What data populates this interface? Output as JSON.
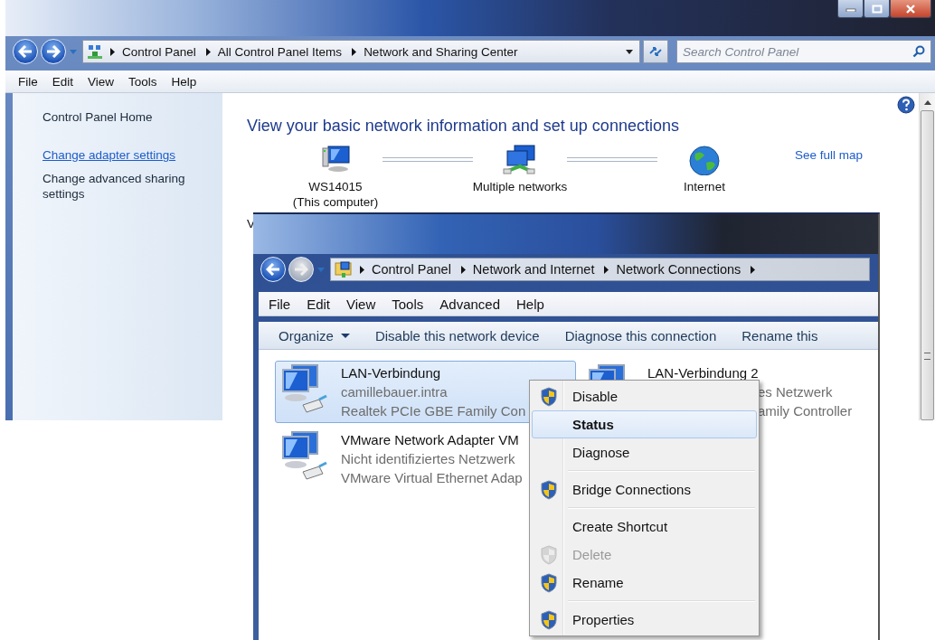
{
  "back_window": {
    "address_bar": {
      "crumbs": [
        "Control Panel",
        "All Control Panel Items",
        "Network and Sharing Center"
      ]
    },
    "search": {
      "placeholder": "Search Control Panel"
    },
    "menu": [
      "File",
      "Edit",
      "View",
      "Tools",
      "Help"
    ],
    "sidebar": {
      "items": [
        {
          "label": "Control Panel Home",
          "kind": "text"
        },
        {
          "label": "Change adapter settings",
          "kind": "link"
        },
        {
          "label": "Change advanced sharing settings",
          "kind": "text"
        }
      ]
    },
    "heading": "View your basic network information and set up connections",
    "map": {
      "nodes": [
        {
          "label": "WS14015",
          "sublabel": "(This computer)",
          "kind": "computer"
        },
        {
          "label": "Multiple networks",
          "kind": "network"
        },
        {
          "label": "Internet",
          "kind": "globe"
        }
      ]
    },
    "see_full_map": "See full map",
    "cut_text": "V"
  },
  "front_window": {
    "address_bar": {
      "crumbs": [
        "Control Panel",
        "Network and Internet",
        "Network Connections"
      ]
    },
    "menu": [
      "File",
      "Edit",
      "View",
      "Tools",
      "Advanced",
      "Help"
    ],
    "toolbar": [
      {
        "label": "Organize",
        "dropdown": true
      },
      {
        "label": "Disable this network device",
        "dropdown": false
      },
      {
        "label": "Diagnose this connection",
        "dropdown": false
      },
      {
        "label": "Rename this",
        "dropdown": false
      }
    ],
    "connections": [
      {
        "name": "LAN-Verbindung",
        "network": "camillebauer.intra",
        "adapter": "Realtek PCIe GBE Family Con",
        "selected": true
      },
      {
        "name": "VMware Network Adapter VM",
        "network": "Nicht identifiziertes Netzwerk",
        "adapter": "VMware Virtual Ethernet Adap",
        "selected": false
      },
      {
        "name": "LAN-Verbindung 2",
        "network": "es Netzwerk",
        "adapter": "amily Controller",
        "selected": false
      }
    ]
  },
  "context_menu": {
    "groups": [
      [
        {
          "label": "Disable",
          "shield": true,
          "disabled": false,
          "selected": false,
          "default": false
        },
        {
          "label": "Status",
          "shield": false,
          "disabled": false,
          "selected": true,
          "default": true
        },
        {
          "label": "Diagnose",
          "shield": false,
          "disabled": false,
          "selected": false,
          "default": false
        }
      ],
      [
        {
          "label": "Bridge Connections",
          "shield": true,
          "disabled": false,
          "selected": false,
          "default": false
        }
      ],
      [
        {
          "label": "Create Shortcut",
          "shield": false,
          "disabled": false,
          "selected": false,
          "default": false
        },
        {
          "label": "Delete",
          "shield": true,
          "disabled": true,
          "selected": false,
          "default": false
        },
        {
          "label": "Rename",
          "shield": true,
          "disabled": false,
          "selected": false,
          "default": false
        }
      ],
      [
        {
          "label": "Properties",
          "shield": true,
          "disabled": false,
          "selected": false,
          "default": false
        }
      ]
    ]
  }
}
